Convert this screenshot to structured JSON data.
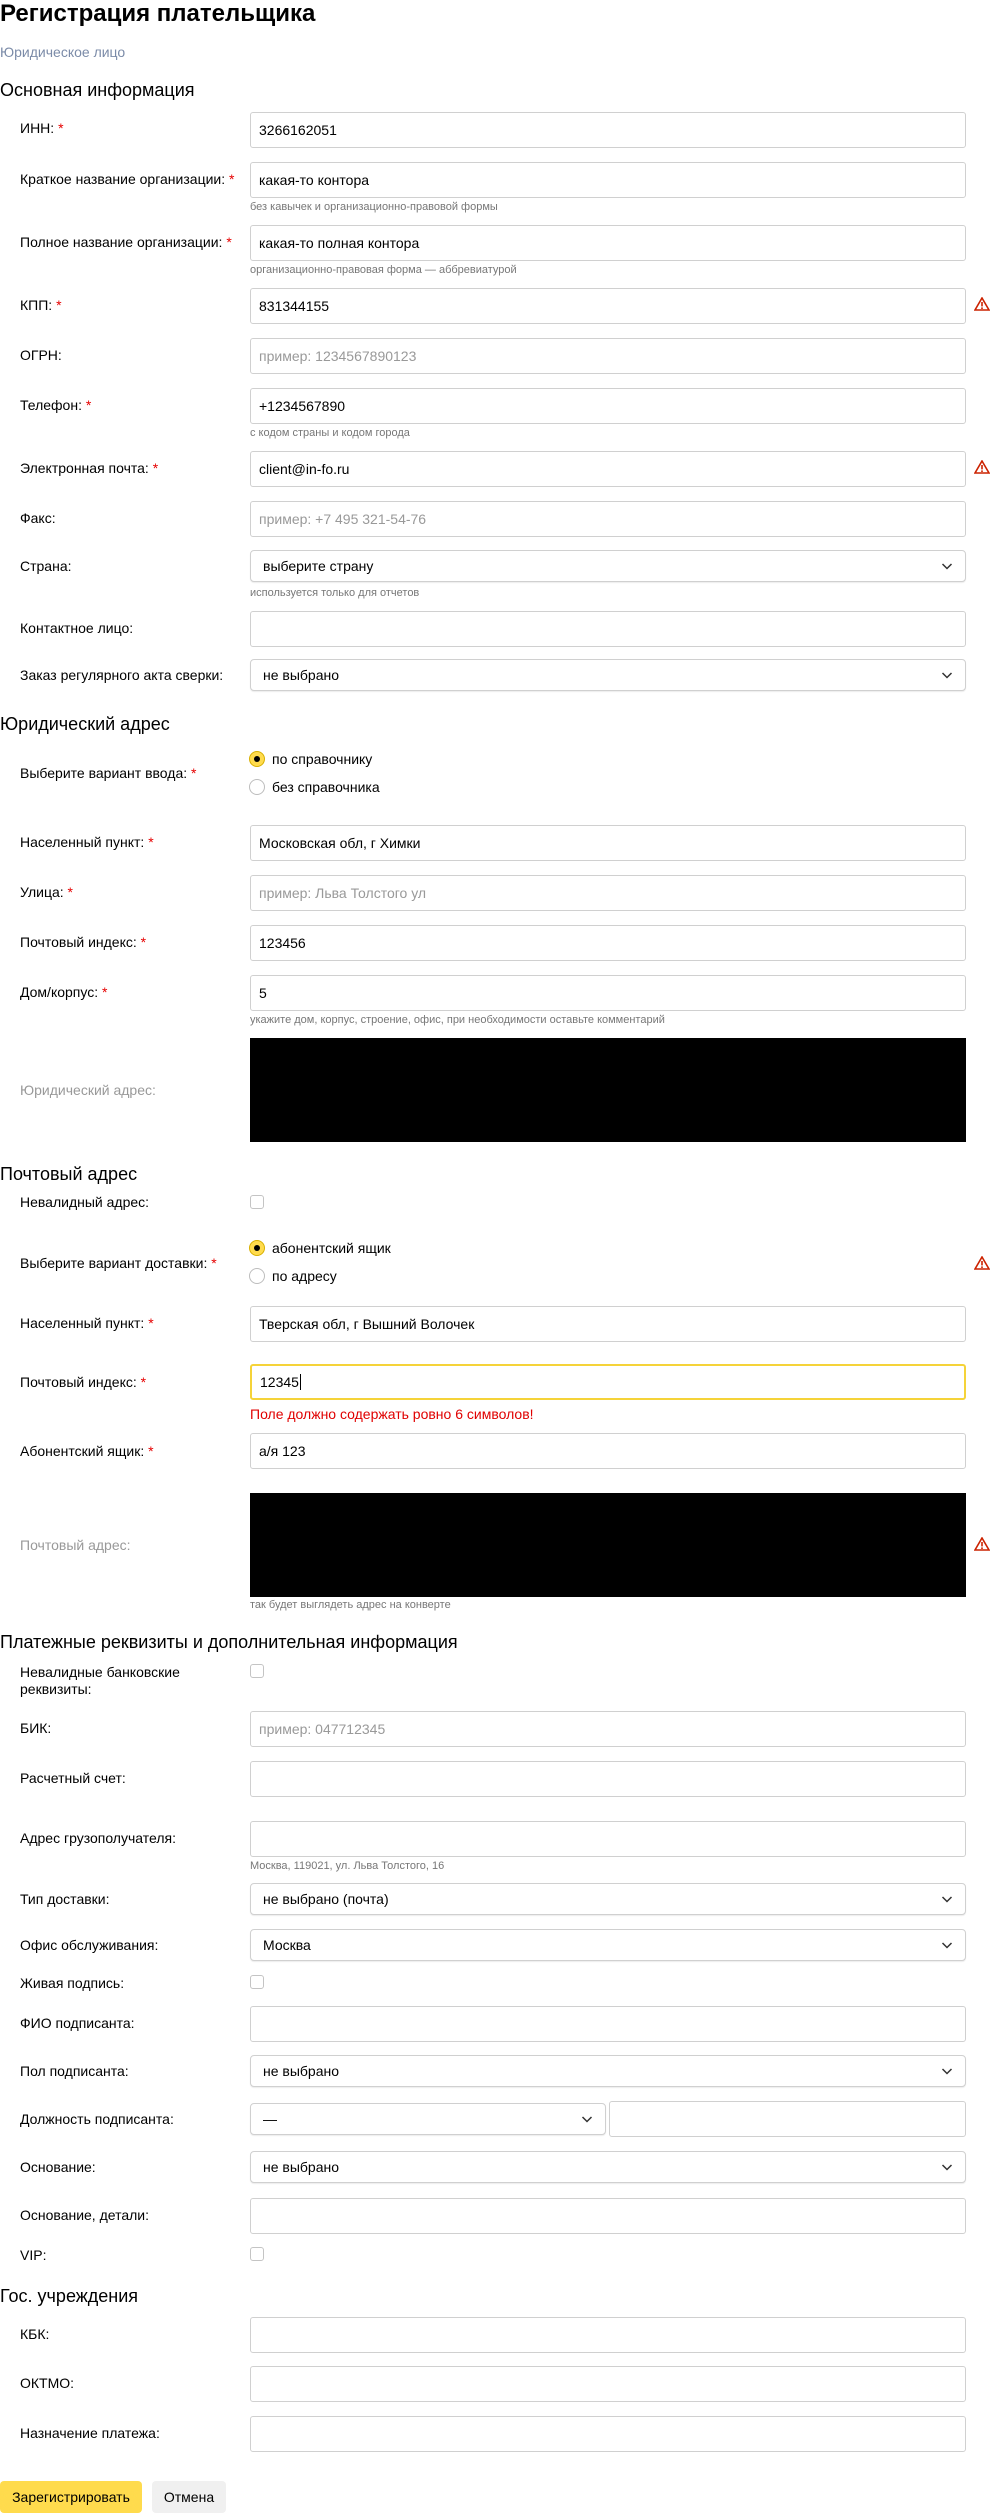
{
  "page": {
    "title": "Регистрация плательщика",
    "subtitle": "Юридическое лицо"
  },
  "sections": {
    "main": "Основная информация",
    "legal_address": "Юридический адрес",
    "postal_address": "Почтовый адрес",
    "payment": "Платежные реквизиты и дополнительная информация",
    "gov": "Гос. учреждения"
  },
  "main": {
    "inn_label": "ИНН:",
    "inn_value": "3266162051",
    "short_name_label": "Краткое название организации:",
    "short_name_value": "какая-то контора",
    "short_name_hint": "без кавычек и организационно-правовой формы",
    "full_name_label": "Полное название организации:",
    "full_name_value": "какая-то полная контора",
    "full_name_hint": "организационно-правовая форма — аббревиатурой",
    "kpp_label": "КПП:",
    "kpp_value": "831344155",
    "ogrn_label": "ОГРН:",
    "ogrn_placeholder": "пример: 1234567890123",
    "phone_label": "Телефон:",
    "phone_value": "+1234567890",
    "phone_hint": "с кодом страны и кодом города",
    "email_label": "Электронная почта:",
    "email_value": "client@in-fo.ru",
    "fax_label": "Факс:",
    "fax_placeholder": "пример: +7 495 321-54-76",
    "country_label": "Страна:",
    "country_value": "выберите страну",
    "country_hint": "используется только для отчетов",
    "contact_label": "Контактное лицо:",
    "contact_value": "",
    "act_label": "Заказ регулярного акта сверки:",
    "act_value": "не выбрано"
  },
  "legal": {
    "input_variant_label": "Выберите вариант ввода:",
    "option_directory": "по справочнику",
    "option_no_directory": "без справочника",
    "selected": "по справочнику",
    "city_label": "Населенный пункт:",
    "city_value": "Московская обл, г Химки",
    "street_label": "Улица:",
    "street_placeholder": "пример: Льва Толстого ул",
    "zip_label": "Почтовый индекс:",
    "zip_value": "123456",
    "house_label": "Дом/корпус:",
    "house_value": "5",
    "house_hint": "укажите дом, корпус, строение, офис, при необходимости оставьте комментарий",
    "address_label": "Юридический адрес:"
  },
  "postal": {
    "invalid_label": "Невалидный адрес:",
    "delivery_label": "Выберите вариант доставки:",
    "option_box": "абонентский ящик",
    "option_address": "по адресу",
    "selected": "абонентский ящик",
    "city_label": "Населенный пункт:",
    "city_value": "Тверская обл, г Вышний Волочек",
    "zip_label": "Почтовый индекс:",
    "zip_value": "12345",
    "zip_error": "Поле должно содержать ровно 6 символов!",
    "box_label": "Абонентский ящик:",
    "box_value": "а/я 123",
    "address_label": "Почтовый адрес:",
    "address_hint": "так будет выглядеть адрес на конверте"
  },
  "payment": {
    "invalid_bank_label": "Невалидные банковские реквизиты:",
    "bik_label": "БИК:",
    "bik_placeholder": "пример: 047712345",
    "account_label": "Расчетный счет:",
    "consignee_label": "Адрес грузополучателя:",
    "consignee_hint": "Москва, 119021, ул. Льва Толстого, 16",
    "delivery_type_label": "Тип доставки:",
    "delivery_type_value": "не выбрано (почта)",
    "office_label": "Офис обслуживания:",
    "office_value": "Москва",
    "live_sign_label": "Живая подпись:",
    "signer_name_label": "ФИО подписанта:",
    "signer_gender_label": "Пол подписанта:",
    "signer_gender_value": "не выбрано",
    "signer_position_label": "Должность подписанта:",
    "signer_position_value": "—",
    "basis_label": "Основание:",
    "basis_value": "не выбрано",
    "basis_details_label": "Основание, детали:",
    "vip_label": "VIP:"
  },
  "gov": {
    "kbk_label": "КБК:",
    "oktmo_label": "ОКТМО:",
    "purpose_label": "Назначение платежа:"
  },
  "buttons": {
    "register": "Зарегистрировать",
    "cancel": "Отмена"
  },
  "colors": {
    "accent": "#ffdb4d",
    "error": "#e00000",
    "required_star": "#e60000",
    "warning_icon": "#cc2200"
  }
}
